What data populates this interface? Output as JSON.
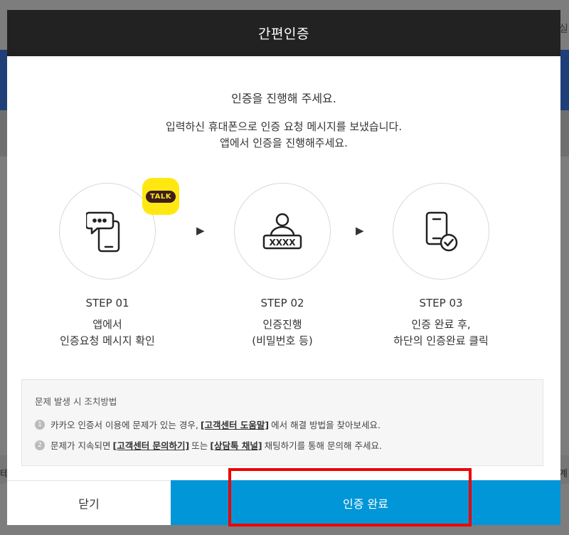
{
  "background": {
    "right_text": "실",
    "right_text2": "계",
    "left_text": "테"
  },
  "modal": {
    "title": "간편인증",
    "intro_title": "인증을 진행해 주세요.",
    "intro_line1": "입력하신 휴대폰으로 인증 요청 메시지를 보냈습니다.",
    "intro_line2": "앱에서 인증을 진행해주세요.",
    "talk_badge": "TALK",
    "steps": [
      {
        "label": "STEP 01",
        "desc1": "앱에서",
        "desc2": "인증요청 메시지 확인",
        "icon": "phone-chat-icon"
      },
      {
        "label": "STEP 02",
        "desc1": "인증진행",
        "desc2": "(비밀번호 등)",
        "icon": "user-password-icon"
      },
      {
        "label": "STEP 03",
        "desc1": "인증 완료 후,",
        "desc2": "하단의 인증완료 클릭",
        "icon": "phone-check-icon"
      }
    ],
    "arrow": "▶",
    "help": {
      "title": "문제 발생 시 조치방법",
      "line1": {
        "num": "1",
        "before": "카카오 인증서 이용에 문제가 있는 경우,",
        "link": "[고객센터 도움말]",
        "after": "에서 해결 방법을 찾아보세요."
      },
      "line2": {
        "num": "2",
        "before": "문제가 지속되면",
        "link1": "[고객센터 문의하기]",
        "middle": "또는",
        "link2": "[상담톡 채널]",
        "after": "채팅하기를 통해 문의해 주세요."
      }
    },
    "buttons": {
      "close": "닫기",
      "done": "인증 완료"
    }
  },
  "colors": {
    "header_bg": "#222222",
    "primary": "#0096d7",
    "kakao_yellow": "#ffe812",
    "highlight": "#ee0000"
  }
}
